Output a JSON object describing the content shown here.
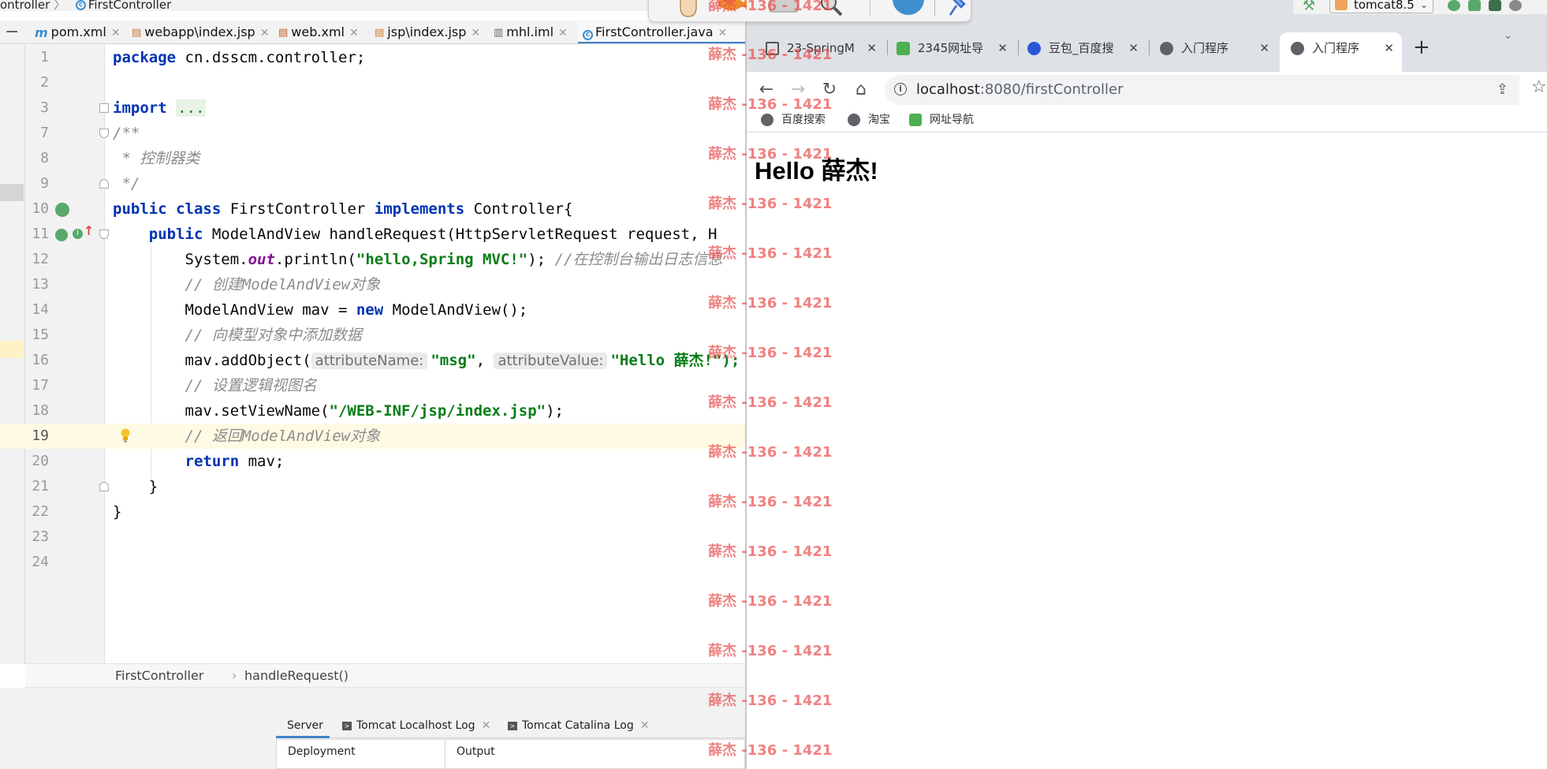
{
  "ide": {
    "breadcrumb": {
      "package_fragment": "ontroller",
      "class_name": "FirstController"
    },
    "editor_tabs": [
      {
        "label": "pom.xml",
        "icon": "maven-m-icon",
        "active": false
      },
      {
        "label": "webapp\\index.jsp",
        "icon": "jsp-file-icon",
        "active": false
      },
      {
        "label": "web.xml",
        "icon": "xml-file-icon",
        "active": false
      },
      {
        "label": "jsp\\index.jsp",
        "icon": "jsp-file-icon",
        "active": false
      },
      {
        "label": "mhl.iml",
        "icon": "module-file-icon",
        "active": false
      },
      {
        "label": "FirstController.java",
        "icon": "java-class-icon",
        "active": true
      }
    ],
    "code_lines": {
      "l1": {
        "num": "1"
      },
      "l2": {
        "num": "2"
      },
      "l3": {
        "num": "3"
      },
      "l7": {
        "num": "7"
      },
      "l8": {
        "num": "8"
      },
      "l9": {
        "num": "9"
      },
      "l10": {
        "num": "10"
      },
      "l11": {
        "num": "11"
      },
      "l12": {
        "num": "12"
      },
      "l13": {
        "num": "13"
      },
      "l14": {
        "num": "14"
      },
      "l15": {
        "num": "15"
      },
      "l16": {
        "num": "16"
      },
      "l17": {
        "num": "17"
      },
      "l18": {
        "num": "18"
      },
      "l19": {
        "num": "19"
      },
      "l20": {
        "num": "20"
      },
      "l21": {
        "num": "21"
      },
      "l22": {
        "num": "22"
      },
      "l23": {
        "num": "23"
      },
      "l24": {
        "num": "24"
      }
    },
    "code": {
      "kw_package": "package",
      "package_name": " cn.dsscm.controller;",
      "kw_import": "import",
      "import_fold": "...",
      "doc_open": "/**",
      "doc_line": " * 控制器类",
      "doc_close": " */",
      "kw_public": "public",
      "kw_class": "class",
      "class_decl": " FirstController ",
      "kw_implements": "implements",
      "interface_decl": " Controller{",
      "method_indent": "    ",
      "method_sig": " ModelAndView handleRequest(HttpServletRequest request, H",
      "system_out_prefix": "        System.",
      "field_out": "out",
      "println_open": ".println(",
      "str_hello": "\"hello,Spring MVC!\"",
      "println_close": "); ",
      "comment_console": "//在控制台输出日志信息",
      "comment_create": "        // 创建ModelAndView对象",
      "mav_decl": "        ModelAndView mav = ",
      "kw_new": "new",
      "mav_ctor": " ModelAndView();",
      "comment_add": "        // 向模型对象中添加数据",
      "add_prefix": "        mav.addObject(",
      "hint_name": "attributeName:",
      "str_msg": "\"msg\"",
      "comma": ", ",
      "hint_value": "attributeValue:",
      "str_hello_val": "\"Hello 薛杰!\");",
      "comment_view": "        // 设置逻辑视图名",
      "setview_prefix": "        mav.setViewName(",
      "str_view": "\"/WEB-INF/jsp/index.jsp\"",
      "setview_close": ");",
      "comment_return": "        // 返回ModelAndView对象",
      "return_indent": "        ",
      "kw_return": "return",
      "return_rest": " mav;",
      "close_method": "    }",
      "close_class": "}"
    },
    "nav_crumbs": {
      "class": "FirstController",
      "method": "handleRequest()"
    },
    "bottom_tabs": [
      {
        "label": "Server",
        "active": true
      },
      {
        "label": "Tomcat Localhost Log",
        "active": false
      },
      {
        "label": "Tomcat Catalina Log",
        "active": false
      }
    ],
    "server_columns": {
      "col1": "Deployment",
      "col2": "Output"
    },
    "run_config": {
      "label": "tomcat8.5"
    }
  },
  "browser": {
    "tabs": [
      {
        "label": "23-SpringM",
        "icon": "page-icon",
        "active": false
      },
      {
        "label": "2345网址导",
        "icon": "2345-icon",
        "active": false
      },
      {
        "label": "豆包_百度搜",
        "icon": "baidu-paw-icon",
        "active": false
      },
      {
        "label": "入门程序",
        "icon": "globe-icon",
        "active": false
      },
      {
        "label": "入门程序",
        "icon": "globe-icon",
        "active": true
      }
    ],
    "address": {
      "host": "localhost",
      "path": ":8080/firstController"
    },
    "bookmarks": [
      {
        "label": "百度搜索",
        "icon": "globe-icon"
      },
      {
        "label": "淘宝",
        "icon": "globe-icon"
      },
      {
        "label": "网址导航",
        "icon": "2345-icon"
      }
    ],
    "page": {
      "heading": "Hello 薛杰!"
    }
  },
  "watermark": {
    "text": "薛杰 -136 - 1421"
  },
  "colors": {
    "keyword": "#0033b3",
    "string": "#067d17",
    "comment": "#8c8c8c",
    "field": "#871094",
    "active_tab_underline": "#4083c9",
    "watermark": "#eb5050"
  }
}
